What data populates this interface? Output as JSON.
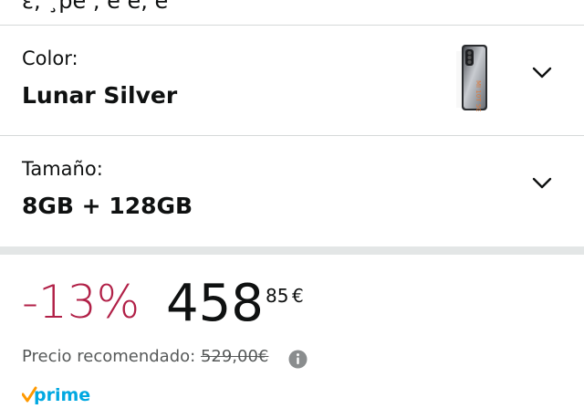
{
  "top_partial_text": "ε, ¸pe , e e, e",
  "color_selector": {
    "label": "Color:",
    "value": "Lunar Silver",
    "product_image_text": "MI 10T 5G"
  },
  "size_selector": {
    "label": "Tamaño:",
    "value": "8GB + 128GB"
  },
  "price": {
    "discount": "-13%",
    "whole": "458",
    "fraction": "85",
    "currency": "€",
    "recommended_label": "Precio recomendado:",
    "recommended_value": "529,00€"
  },
  "badge": {
    "prime_label": "prime"
  },
  "colors": {
    "discount": "#b12047",
    "prime_blue": "#00a8e1",
    "prime_check": "#ff9900",
    "divider": "#d5d9d9"
  }
}
